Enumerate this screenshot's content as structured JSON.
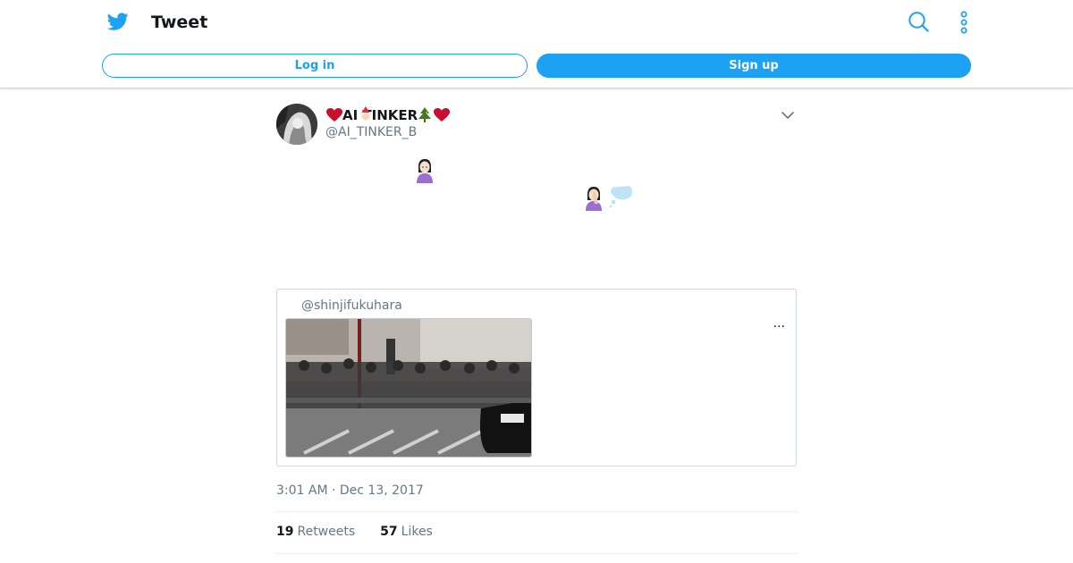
{
  "header": {
    "title": "Tweet",
    "login_label": "Log in",
    "signup_label": "Sign up",
    "icons": [
      "twitter-bird-icon",
      "search-icon",
      "more-vertical-icon"
    ],
    "accent_color": "#1da1f2"
  },
  "tweet": {
    "author": {
      "name": "AI TINKER",
      "name_emojis": [
        "red-heart",
        "santa",
        "christmas-tree",
        "red-heart"
      ],
      "handle": "@AI_TINKER_B"
    },
    "body_emojis": [
      "woman-raising-hand",
      "woman-facepalming",
      "thought-balloon"
    ],
    "quoted": {
      "handle": "@shinjifukuhara",
      "more_label": "···"
    },
    "timestamp": "3:01 AM · Dec 13, 2017",
    "stats": {
      "retweets_count": "19",
      "retweets_label": "Retweets",
      "likes_count": "57",
      "likes_label": "Likes"
    }
  }
}
